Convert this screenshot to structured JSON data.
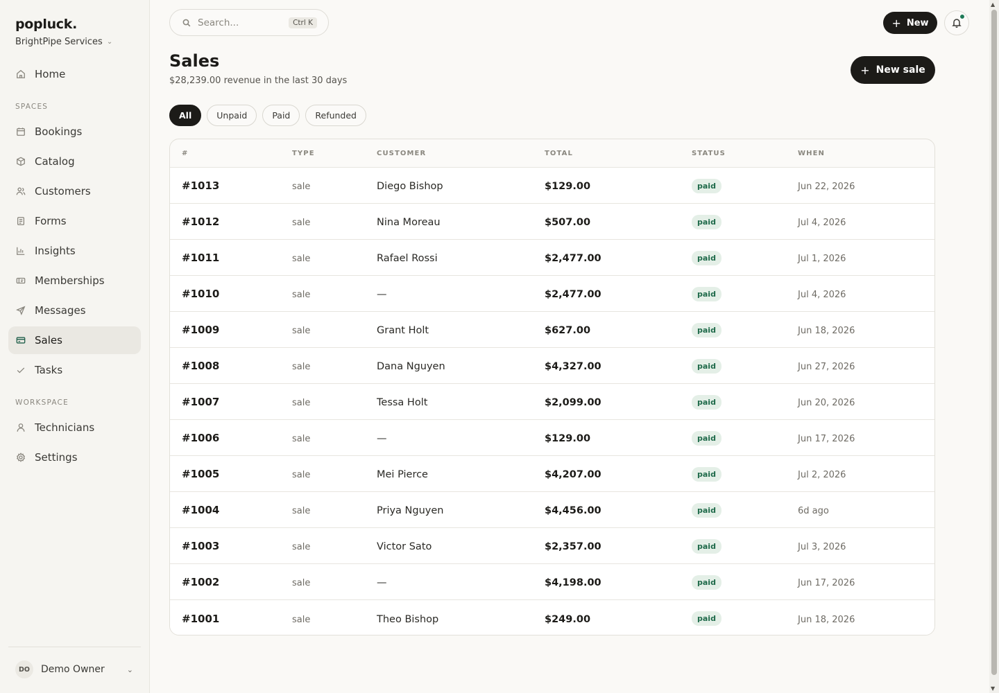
{
  "sidebar": {
    "brand": "popluck",
    "brand_dot": ".",
    "org": "BrightPipe Services",
    "home": "Home",
    "spaces_label": "SPACES",
    "spaces": [
      {
        "label": "Bookings",
        "icon": "calendar-icon"
      },
      {
        "label": "Catalog",
        "icon": "box-icon"
      },
      {
        "label": "Customers",
        "icon": "users-icon"
      },
      {
        "label": "Forms",
        "icon": "form-icon"
      },
      {
        "label": "Insights",
        "icon": "chart-icon"
      },
      {
        "label": "Memberships",
        "icon": "ticket-icon"
      },
      {
        "label": "Messages",
        "icon": "send-icon"
      },
      {
        "label": "Sales",
        "icon": "card-icon",
        "active": true
      },
      {
        "label": "Tasks",
        "icon": "check-icon"
      }
    ],
    "workspace_label": "WORKSPACE",
    "workspace": [
      {
        "label": "Technicians",
        "icon": "user-icon"
      },
      {
        "label": "Settings",
        "icon": "gear-icon"
      }
    ],
    "owner_initials": "DO",
    "owner_name": "Demo Owner"
  },
  "header": {
    "search_placeholder": "Search...",
    "search_shortcut": "Ctrl K",
    "new_label": "New"
  },
  "page": {
    "title": "Sales",
    "subtitle": "$28,239.00 revenue in the last 30 days",
    "new_sale_label": "New sale",
    "filters": [
      "All",
      "Unpaid",
      "Paid",
      "Refunded"
    ],
    "active_filter": "All"
  },
  "table": {
    "columns": [
      "#",
      "TYPE",
      "CUSTOMER",
      "TOTAL",
      "STATUS",
      "WHEN"
    ],
    "rows": [
      {
        "num": "#1013",
        "type": "sale",
        "customer": "Diego Bishop",
        "total": "$129.00",
        "status": "paid",
        "when": "Jun 22, 2026"
      },
      {
        "num": "#1012",
        "type": "sale",
        "customer": "Nina Moreau",
        "total": "$507.00",
        "status": "paid",
        "when": "Jul 4, 2026"
      },
      {
        "num": "#1011",
        "type": "sale",
        "customer": "Rafael Rossi",
        "total": "$2,477.00",
        "status": "paid",
        "when": "Jul 1, 2026"
      },
      {
        "num": "#1010",
        "type": "sale",
        "customer": "—",
        "total": "$2,477.00",
        "status": "paid",
        "when": "Jul 4, 2026"
      },
      {
        "num": "#1009",
        "type": "sale",
        "customer": "Grant Holt",
        "total": "$627.00",
        "status": "paid",
        "when": "Jun 18, 2026"
      },
      {
        "num": "#1008",
        "type": "sale",
        "customer": "Dana Nguyen",
        "total": "$4,327.00",
        "status": "paid",
        "when": "Jun 27, 2026"
      },
      {
        "num": "#1007",
        "type": "sale",
        "customer": "Tessa Holt",
        "total": "$2,099.00",
        "status": "paid",
        "when": "Jun 20, 2026"
      },
      {
        "num": "#1006",
        "type": "sale",
        "customer": "—",
        "total": "$129.00",
        "status": "paid",
        "when": "Jun 17, 2026"
      },
      {
        "num": "#1005",
        "type": "sale",
        "customer": "Mei Pierce",
        "total": "$4,207.00",
        "status": "paid",
        "when": "Jul 2, 2026"
      },
      {
        "num": "#1004",
        "type": "sale",
        "customer": "Priya Nguyen",
        "total": "$4,456.00",
        "status": "paid",
        "when": "6d ago"
      },
      {
        "num": "#1003",
        "type": "sale",
        "customer": "Victor Sato",
        "total": "$2,357.00",
        "status": "paid",
        "when": "Jul 3, 2026"
      },
      {
        "num": "#1002",
        "type": "sale",
        "customer": "—",
        "total": "$4,198.00",
        "status": "paid",
        "when": "Jun 17, 2026"
      },
      {
        "num": "#1001",
        "type": "sale",
        "customer": "Theo Bishop",
        "total": "$249.00",
        "status": "paid",
        "when": "Jun 18, 2026"
      }
    ]
  },
  "colors": {
    "accent": "#1c1b18",
    "status_paid_bg": "#e4efe7",
    "status_paid_text": "#1f6a4a",
    "notification_dot": "#1f7a57"
  }
}
